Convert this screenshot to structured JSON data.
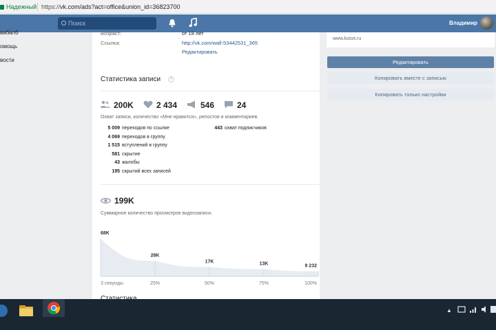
{
  "browser": {
    "secure_label": "Надежный",
    "url_prefix": "https://",
    "url_rest": "vk.com/ads?act=office&union_id=36823700"
  },
  "header": {
    "search_placeholder": "Поиск",
    "user_name": "Владимир"
  },
  "left_nav": {
    "items": [
      {
        "label": "вабалб"
      },
      {
        "label": "омощь"
      },
      {
        "label": "вости"
      }
    ]
  },
  "post_info": {
    "age_label": "Возраст:",
    "age_value": "от 18 лет",
    "link_label": "Ссылка:",
    "link_value": "http://vk.com/wall-53442531_365",
    "edit_link": "Редактировать"
  },
  "stats": {
    "title": "Статистика записи",
    "help": "?",
    "reach": "200K",
    "likes": "2 434",
    "reposts": "546",
    "comments": "24",
    "description": "Охват записи, количество «Мне нравится», репостов и комментариев.",
    "rows_left": [
      {
        "value": "5 009",
        "label": "переходов по ссылке"
      },
      {
        "value": "4 069",
        "label": "переходов в группу"
      },
      {
        "value": "1 515",
        "label": "вступлений в группу"
      },
      {
        "value": "581",
        "label": "скрытие"
      },
      {
        "value": "43",
        "label": "жалобы"
      },
      {
        "value": "195",
        "label": "скрытий всех записей"
      }
    ],
    "rows_right": [
      {
        "value": "443",
        "label": "охват подписчиков"
      }
    ]
  },
  "video": {
    "views": "199K",
    "description": "Суммарное количество просмотров видеозаписи."
  },
  "chart_data": {
    "type": "area",
    "categories": [
      "3 секунды",
      "25%",
      "50%",
      "75%",
      "100%"
    ],
    "values": [
      68000,
      28000,
      17000,
      13000,
      9232
    ],
    "value_labels": [
      "68K",
      "28K",
      "17K",
      "13K",
      "9 232"
    ],
    "title": "",
    "xlabel": "",
    "ylabel": "",
    "ylim": [
      0,
      68000
    ],
    "colors": {
      "fill": "#e7ecf2",
      "line": "#c9d4df"
    }
  },
  "next_section": {
    "title": "Статистика"
  },
  "right_panel": {
    "site": "www.kosvt.ru",
    "edit_button": "Редактировать",
    "copy_with_post_button": "Копировать вместе с записью",
    "copy_settings_button": "Копировать только настройки"
  },
  "taskbar": {
    "tray_arrow": "▲"
  },
  "colors": {
    "vk_blue": "#4a76a8",
    "primary_button": "#5e81a8",
    "secondary_button": "#e5ebf1",
    "taskbar": "#1a2733"
  }
}
